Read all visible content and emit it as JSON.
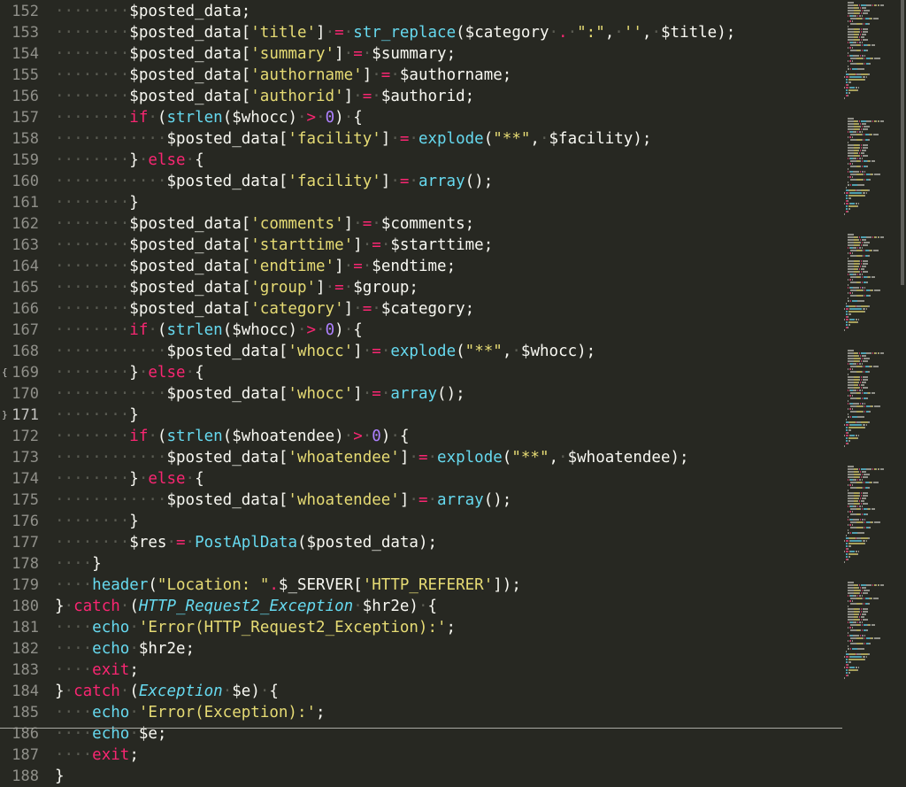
{
  "editor": {
    "active_line": "171",
    "fold_open_line": "169",
    "fold_close_line": "171",
    "fold_marker_open": "{",
    "fold_marker_close": "}",
    "lines": [
      {
        "n": "152",
        "t": [
          [
            "ws",
            "········"
          ],
          [
            "p",
            "$posted_data;"
          ]
        ]
      },
      {
        "n": "153",
        "t": [
          [
            "ws",
            "········"
          ],
          [
            "p",
            "$posted_data["
          ],
          [
            "s",
            "'title'"
          ],
          [
            "p",
            "]"
          ],
          [
            "ws",
            "·"
          ],
          [
            "o",
            "="
          ],
          [
            "ws",
            "·"
          ],
          [
            "f",
            "str_replace"
          ],
          [
            "p",
            "($category"
          ],
          [
            "ws",
            "·"
          ],
          [
            "o",
            "."
          ],
          [
            "ws",
            "·"
          ],
          [
            "s",
            "\":\""
          ],
          [
            "p",
            ","
          ],
          [
            "ws",
            "·"
          ],
          [
            "s",
            "''"
          ],
          [
            "p",
            ","
          ],
          [
            "ws",
            "·"
          ],
          [
            "p",
            "$title);"
          ]
        ]
      },
      {
        "n": "154",
        "t": [
          [
            "ws",
            "········"
          ],
          [
            "p",
            "$posted_data["
          ],
          [
            "s",
            "'summary'"
          ],
          [
            "p",
            "]"
          ],
          [
            "ws",
            "·"
          ],
          [
            "o",
            "="
          ],
          [
            "ws",
            "·"
          ],
          [
            "p",
            "$summary;"
          ]
        ]
      },
      {
        "n": "155",
        "t": [
          [
            "ws",
            "········"
          ],
          [
            "p",
            "$posted_data["
          ],
          [
            "s",
            "'authorname'"
          ],
          [
            "p",
            "]"
          ],
          [
            "ws",
            "·"
          ],
          [
            "o",
            "="
          ],
          [
            "ws",
            "·"
          ],
          [
            "p",
            "$authorname;"
          ]
        ]
      },
      {
        "n": "156",
        "t": [
          [
            "ws",
            "········"
          ],
          [
            "p",
            "$posted_data["
          ],
          [
            "s",
            "'authorid'"
          ],
          [
            "p",
            "]"
          ],
          [
            "ws",
            "·"
          ],
          [
            "o",
            "="
          ],
          [
            "ws",
            "·"
          ],
          [
            "p",
            "$authorid;"
          ]
        ]
      },
      {
        "n": "157",
        "t": [
          [
            "ws",
            "········"
          ],
          [
            "k",
            "if"
          ],
          [
            "ws",
            "·"
          ],
          [
            "p",
            "("
          ],
          [
            "f",
            "strlen"
          ],
          [
            "p",
            "($whocc)"
          ],
          [
            "ws",
            "·"
          ],
          [
            "o",
            ">"
          ],
          [
            "ws",
            "·"
          ],
          [
            "n",
            "0"
          ],
          [
            "p",
            ")"
          ],
          [
            "ws",
            "·"
          ],
          [
            "p",
            "{"
          ]
        ]
      },
      {
        "n": "158",
        "t": [
          [
            "ws",
            "············"
          ],
          [
            "p",
            "$posted_data["
          ],
          [
            "s",
            "'facility'"
          ],
          [
            "p",
            "]"
          ],
          [
            "ws",
            "·"
          ],
          [
            "o",
            "="
          ],
          [
            "ws",
            "·"
          ],
          [
            "f",
            "explode"
          ],
          [
            "p",
            "("
          ],
          [
            "s",
            "\"**\""
          ],
          [
            "p",
            ","
          ],
          [
            "ws",
            "·"
          ],
          [
            "p",
            "$facility);"
          ]
        ]
      },
      {
        "n": "159",
        "t": [
          [
            "ws",
            "········"
          ],
          [
            "p",
            "}"
          ],
          [
            "ws",
            "·"
          ],
          [
            "k",
            "else"
          ],
          [
            "ws",
            "·"
          ],
          [
            "p",
            "{"
          ]
        ]
      },
      {
        "n": "160",
        "t": [
          [
            "ws",
            "············"
          ],
          [
            "p",
            "$posted_data["
          ],
          [
            "s",
            "'facility'"
          ],
          [
            "p",
            "]"
          ],
          [
            "ws",
            "·"
          ],
          [
            "o",
            "="
          ],
          [
            "ws",
            "·"
          ],
          [
            "f",
            "array"
          ],
          [
            "p",
            "();"
          ]
        ]
      },
      {
        "n": "161",
        "t": [
          [
            "ws",
            "········"
          ],
          [
            "p",
            "}"
          ]
        ]
      },
      {
        "n": "162",
        "t": [
          [
            "ws",
            "········"
          ],
          [
            "p",
            "$posted_data["
          ],
          [
            "s",
            "'comments'"
          ],
          [
            "p",
            "]"
          ],
          [
            "ws",
            "·"
          ],
          [
            "o",
            "="
          ],
          [
            "ws",
            "·"
          ],
          [
            "p",
            "$comments;"
          ]
        ]
      },
      {
        "n": "163",
        "t": [
          [
            "ws",
            "········"
          ],
          [
            "p",
            "$posted_data["
          ],
          [
            "s",
            "'starttime'"
          ],
          [
            "p",
            "]"
          ],
          [
            "ws",
            "·"
          ],
          [
            "o",
            "="
          ],
          [
            "ws",
            "·"
          ],
          [
            "p",
            "$starttime;"
          ]
        ]
      },
      {
        "n": "164",
        "t": [
          [
            "ws",
            "········"
          ],
          [
            "p",
            "$posted_data["
          ],
          [
            "s",
            "'endtime'"
          ],
          [
            "p",
            "]"
          ],
          [
            "ws",
            "·"
          ],
          [
            "o",
            "="
          ],
          [
            "ws",
            "·"
          ],
          [
            "p",
            "$endtime;"
          ]
        ]
      },
      {
        "n": "165",
        "t": [
          [
            "ws",
            "········"
          ],
          [
            "p",
            "$posted_data["
          ],
          [
            "s",
            "'group'"
          ],
          [
            "p",
            "]"
          ],
          [
            "ws",
            "·"
          ],
          [
            "o",
            "="
          ],
          [
            "ws",
            "·"
          ],
          [
            "p",
            "$group;"
          ]
        ]
      },
      {
        "n": "166",
        "t": [
          [
            "ws",
            "········"
          ],
          [
            "p",
            "$posted_data["
          ],
          [
            "s",
            "'category'"
          ],
          [
            "p",
            "]"
          ],
          [
            "ws",
            "·"
          ],
          [
            "o",
            "="
          ],
          [
            "ws",
            "·"
          ],
          [
            "p",
            "$category;"
          ]
        ]
      },
      {
        "n": "167",
        "t": [
          [
            "ws",
            "········"
          ],
          [
            "k",
            "if"
          ],
          [
            "ws",
            "·"
          ],
          [
            "p",
            "("
          ],
          [
            "f",
            "strlen"
          ],
          [
            "p",
            "($whocc)"
          ],
          [
            "ws",
            "·"
          ],
          [
            "o",
            ">"
          ],
          [
            "ws",
            "·"
          ],
          [
            "n",
            "0"
          ],
          [
            "p",
            ")"
          ],
          [
            "ws",
            "·"
          ],
          [
            "p",
            "{"
          ]
        ]
      },
      {
        "n": "168",
        "t": [
          [
            "ws",
            "············"
          ],
          [
            "p",
            "$posted_data["
          ],
          [
            "s",
            "'whocc'"
          ],
          [
            "p",
            "]"
          ],
          [
            "ws",
            "·"
          ],
          [
            "o",
            "="
          ],
          [
            "ws",
            "·"
          ],
          [
            "f",
            "explode"
          ],
          [
            "p",
            "("
          ],
          [
            "s",
            "\"**\""
          ],
          [
            "p",
            ","
          ],
          [
            "ws",
            "·"
          ],
          [
            "p",
            "$whocc);"
          ]
        ]
      },
      {
        "n": "169",
        "t": [
          [
            "ws",
            "········"
          ],
          [
            "p",
            "}"
          ],
          [
            "ws",
            "·"
          ],
          [
            "k",
            "else"
          ],
          [
            "ws",
            "·"
          ],
          [
            "p",
            "{"
          ]
        ]
      },
      {
        "n": "170",
        "t": [
          [
            "ws",
            "············"
          ],
          [
            "p",
            "$posted_data["
          ],
          [
            "s",
            "'whocc'"
          ],
          [
            "p",
            "]"
          ],
          [
            "ws",
            "·"
          ],
          [
            "o",
            "="
          ],
          [
            "ws",
            "·"
          ],
          [
            "f",
            "array"
          ],
          [
            "p",
            "();"
          ]
        ]
      },
      {
        "n": "171",
        "t": [
          [
            "ws",
            "········"
          ],
          [
            "p",
            "}"
          ]
        ]
      },
      {
        "n": "172",
        "t": [
          [
            "ws",
            "········"
          ],
          [
            "k",
            "if"
          ],
          [
            "ws",
            "·"
          ],
          [
            "p",
            "("
          ],
          [
            "f",
            "strlen"
          ],
          [
            "p",
            "($whoatendee)"
          ],
          [
            "ws",
            "·"
          ],
          [
            "o",
            ">"
          ],
          [
            "ws",
            "·"
          ],
          [
            "n",
            "0"
          ],
          [
            "p",
            ")"
          ],
          [
            "ws",
            "·"
          ],
          [
            "p",
            "{"
          ]
        ]
      },
      {
        "n": "173",
        "t": [
          [
            "ws",
            "············"
          ],
          [
            "p",
            "$posted_data["
          ],
          [
            "s",
            "'whoatendee'"
          ],
          [
            "p",
            "]"
          ],
          [
            "ws",
            "·"
          ],
          [
            "o",
            "="
          ],
          [
            "ws",
            "·"
          ],
          [
            "f",
            "explode"
          ],
          [
            "p",
            "("
          ],
          [
            "s",
            "\"**\""
          ],
          [
            "p",
            ","
          ],
          [
            "ws",
            "·"
          ],
          [
            "p",
            "$whoatendee);"
          ]
        ]
      },
      {
        "n": "174",
        "t": [
          [
            "ws",
            "········"
          ],
          [
            "p",
            "}"
          ],
          [
            "ws",
            "·"
          ],
          [
            "k",
            "else"
          ],
          [
            "ws",
            "·"
          ],
          [
            "p",
            "{"
          ]
        ]
      },
      {
        "n": "175",
        "t": [
          [
            "ws",
            "············"
          ],
          [
            "p",
            "$posted_data["
          ],
          [
            "s",
            "'whoatendee'"
          ],
          [
            "p",
            "]"
          ],
          [
            "ws",
            "·"
          ],
          [
            "o",
            "="
          ],
          [
            "ws",
            "·"
          ],
          [
            "f",
            "array"
          ],
          [
            "p",
            "();"
          ]
        ]
      },
      {
        "n": "176",
        "t": [
          [
            "ws",
            "········"
          ],
          [
            "p",
            "}"
          ]
        ]
      },
      {
        "n": "177",
        "t": [
          [
            "ws",
            "········"
          ],
          [
            "p",
            "$res"
          ],
          [
            "ws",
            "·"
          ],
          [
            "o",
            "="
          ],
          [
            "ws",
            "·"
          ],
          [
            "f",
            "PostAplData"
          ],
          [
            "p",
            "($posted_data);"
          ]
        ]
      },
      {
        "n": "178",
        "t": [
          [
            "ws",
            "····"
          ],
          [
            "p",
            "}"
          ]
        ]
      },
      {
        "n": "179",
        "t": [
          [
            "ws",
            "····"
          ],
          [
            "f",
            "header"
          ],
          [
            "p",
            "("
          ],
          [
            "s",
            "\"Location: \""
          ],
          [
            "o",
            "."
          ],
          [
            "p",
            "$_SERVER["
          ],
          [
            "s",
            "'HTTP_REFERER'"
          ],
          [
            "p",
            "]);"
          ]
        ]
      },
      {
        "n": "180",
        "t": [
          [
            "p",
            "}"
          ],
          [
            "ws",
            "·"
          ],
          [
            "k",
            "catch"
          ],
          [
            "ws",
            "·"
          ],
          [
            "p",
            "("
          ],
          [
            "t",
            "HTTP_Request2_Exception"
          ],
          [
            "ws",
            "·"
          ],
          [
            "p",
            "$hr2e)"
          ],
          [
            "ws",
            "·"
          ],
          [
            "p",
            "{"
          ]
        ]
      },
      {
        "n": "181",
        "t": [
          [
            "ws",
            "····"
          ],
          [
            "f",
            "echo"
          ],
          [
            "ws",
            "·"
          ],
          [
            "s",
            "'Error(HTTP_Request2_Exception):'"
          ],
          [
            "p",
            ";"
          ]
        ]
      },
      {
        "n": "182",
        "t": [
          [
            "ws",
            "····"
          ],
          [
            "f",
            "echo"
          ],
          [
            "ws",
            "·"
          ],
          [
            "p",
            "$hr2e;"
          ]
        ]
      },
      {
        "n": "183",
        "t": [
          [
            "ws",
            "····"
          ],
          [
            "k",
            "exit"
          ],
          [
            "p",
            ";"
          ]
        ]
      },
      {
        "n": "184",
        "t": [
          [
            "p",
            "}"
          ],
          [
            "ws",
            "·"
          ],
          [
            "k",
            "catch"
          ],
          [
            "ws",
            "·"
          ],
          [
            "p",
            "("
          ],
          [
            "t",
            "Exception"
          ],
          [
            "ws",
            "·"
          ],
          [
            "p",
            "$e)"
          ],
          [
            "ws",
            "·"
          ],
          [
            "p",
            "{"
          ]
        ]
      },
      {
        "n": "185",
        "t": [
          [
            "ws",
            "····"
          ],
          [
            "f",
            "echo"
          ],
          [
            "ws",
            "·"
          ],
          [
            "s",
            "'Error(Exception):'"
          ],
          [
            "p",
            ";"
          ]
        ]
      },
      {
        "n": "186",
        "t": [
          [
            "ws",
            "····"
          ],
          [
            "f",
            "echo"
          ],
          [
            "ws",
            "·"
          ],
          [
            "p",
            "$e;"
          ]
        ]
      },
      {
        "n": "187",
        "t": [
          [
            "ws",
            "····"
          ],
          [
            "k",
            "exit"
          ],
          [
            "p",
            ";"
          ]
        ]
      },
      {
        "n": "188",
        "t": [
          [
            "p",
            "}"
          ]
        ]
      }
    ]
  },
  "colors": {
    "background": "#272822",
    "plain": "#f8f8f2",
    "keyword": "#f92672",
    "string": "#e6db74",
    "function": "#66d9ef",
    "number": "#ae81ff",
    "whitespace": "#5a5b52",
    "line_number": "#90908a"
  },
  "minimap": {
    "icon": "minimap"
  },
  "scrollbar": {
    "icon": "vertical-scrollbar"
  }
}
